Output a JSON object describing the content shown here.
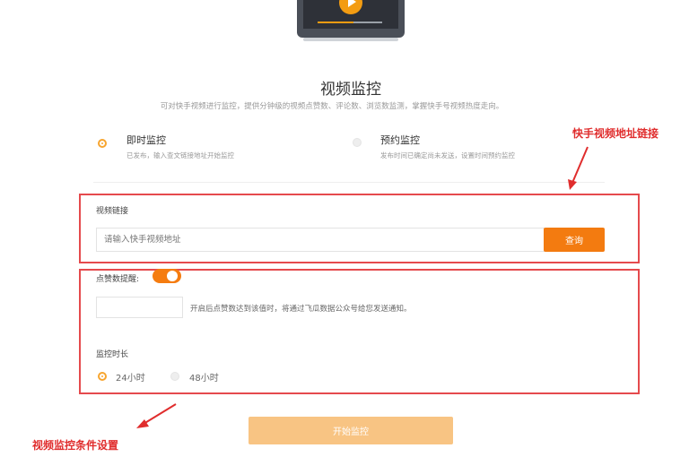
{
  "header": {
    "title": "视频监控",
    "subtitle": "可对快手视频进行监控，提供分钟级的视频点赞数、评论数、浏览数监测，掌握快手号视频热度走向。",
    "progress": 0.55
  },
  "modes": [
    {
      "title": "即时监控",
      "desc": "已发布，输入查文链接地址开始监控",
      "selected": true
    },
    {
      "title": "预约监控",
      "desc": "发布时间已确定尚未发送，设置时间预约监控",
      "selected": false
    }
  ],
  "link_section": {
    "label": "视频链接",
    "placeholder": "请输入快手视频地址",
    "query_button": "查询"
  },
  "conditions": {
    "like_reminder_label": "点赞数提醒:",
    "reminder_on": true,
    "threshold_hint": "开启后点赞数达到该值时，将通过飞瓜数据公众号给您发送通知。",
    "duration_label": "监控时长",
    "durations": [
      {
        "label": "24小时",
        "selected": true
      },
      {
        "label": "48小时",
        "selected": false
      }
    ]
  },
  "start_button": "开始监控",
  "annotations": {
    "link_note": "快手视频地址链接",
    "condition_note": "视频监控条件设置",
    "color": "#e02d2d"
  },
  "colors": {
    "accent": "#f37b10",
    "annotation": "#e54a4d"
  }
}
